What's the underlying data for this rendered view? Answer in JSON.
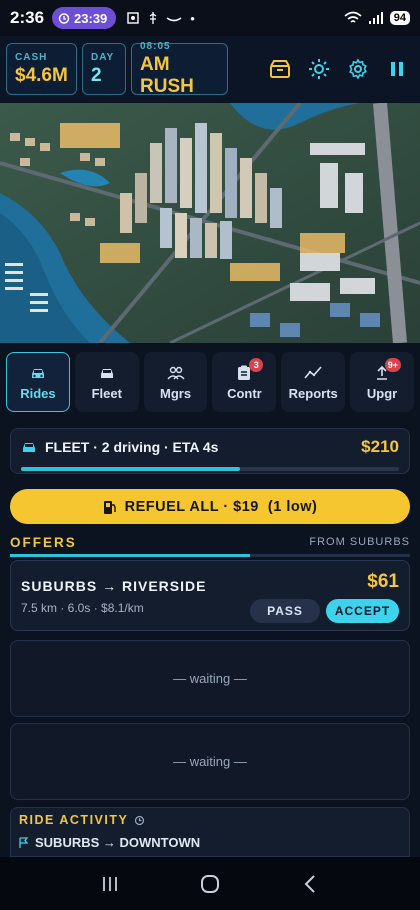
{
  "status_bar": {
    "time": "2:36",
    "alarm_time": "23:39",
    "battery": "94"
  },
  "hud": {
    "cash_label": "CASH",
    "cash_value": "$4.6M",
    "day_label": "DAY",
    "day_value": "2",
    "clock_label": "08:05",
    "clock_value": "AM RUSH",
    "buttons": [
      "shop-icon",
      "sun-icon",
      "gear-icon",
      "pause-icon"
    ]
  },
  "tabs": [
    {
      "label": "Rides",
      "icon": "car-icon",
      "badge": "",
      "active": true
    },
    {
      "label": "Fleet",
      "icon": "car-front-icon",
      "badge": ""
    },
    {
      "label": "Mgrs",
      "icon": "people-icon",
      "badge": ""
    },
    {
      "label": "Contr",
      "icon": "clipboard-icon",
      "badge": "3"
    },
    {
      "label": "Reports",
      "icon": "chart-icon",
      "badge": ""
    },
    {
      "label": "Upgr",
      "icon": "upgrade-icon",
      "badge": "9+"
    }
  ],
  "fleet": {
    "text": "FLEET · 2 driving · ETA 4s",
    "amount": "$210",
    "progress": 0.58
  },
  "refuel": {
    "label": "REFUEL ALL · $19  (1 low)"
  },
  "offers": {
    "title": "OFFERS",
    "subtitle": "FROM SUBURBS",
    "progress": 0.6,
    "current": {
      "route": "SUBURBS → RIVERSIDE",
      "meta": "7.5 km · 6.0s · $8.1/km",
      "price": "$61",
      "pass_label": "PASS",
      "accept_label": "ACCEPT"
    },
    "waiting_1": "— waiting —",
    "waiting_2": "— waiting —"
  },
  "activity": {
    "title": "RIDE ACTIVITY",
    "items": [
      {
        "text": "SUBURBS → DOWNTOWN"
      }
    ]
  },
  "colors": {
    "accent_cyan": "#3ed3ec",
    "accent_gold": "#f4c542",
    "background": "#0b1220"
  }
}
